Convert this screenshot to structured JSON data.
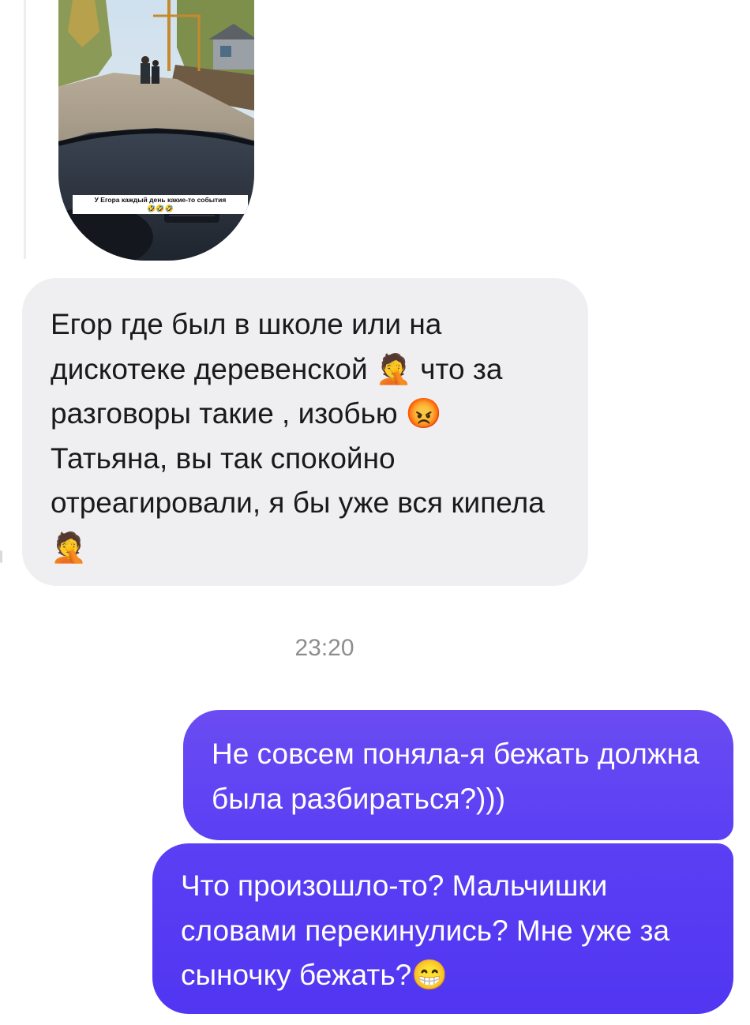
{
  "story": {
    "caption": "У Егора каждый день какие-то события",
    "caption_emoji": "🤣🤣🤣"
  },
  "messages": [
    {
      "direction": "incoming",
      "text": "Егор где был в школе или на дискотеке деревенской 🤦 что за разговоры такие , изобью 😡 Татьяна, вы так спокойно отреагировали, я бы уже вся кипела 🤦"
    },
    {
      "direction": "outgoing",
      "text": "Не совсем поняла-я бежать должна была разбираться?)))"
    },
    {
      "direction": "outgoing",
      "text": "Что произошло-то? Мальчишки словами перекинулись? Мне уже за сыночку бежать?😁"
    }
  ],
  "timestamp": "23:20",
  "colors": {
    "incoming_bubble": "#efeff1",
    "outgoing_bubble": "#5a3ff4",
    "timestamp": "#8d8d8d"
  }
}
